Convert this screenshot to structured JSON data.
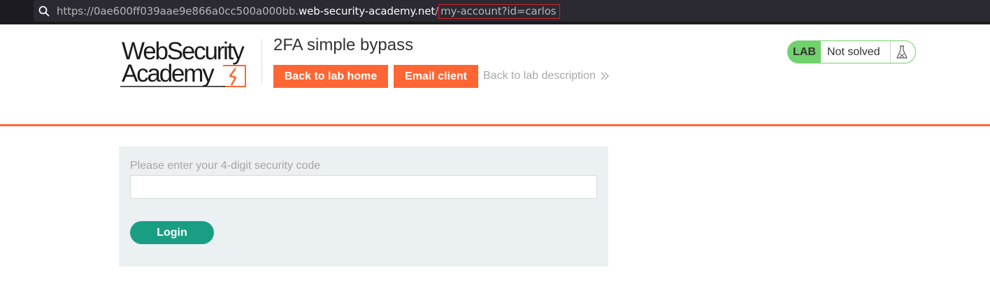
{
  "browser": {
    "url_prefix": "https://0ae600ff039aae9e866a0cc500a000bb.",
    "url_domain": "web-security-academy.net",
    "url_slash": "/",
    "url_path_highlighted": "my-account?id=carlos",
    "highlight_color": "#d2232a"
  },
  "logo": {
    "line1": "WebSecurity",
    "line2": "Academy"
  },
  "header": {
    "lab_title": "2FA simple bypass",
    "back_to_lab_home": "Back to lab home",
    "email_client": "Email client",
    "back_to_description": "Back to lab description"
  },
  "status": {
    "badge": "LAB",
    "text": "Not solved",
    "icon": "flask-icon",
    "badge_color": "#70d16d"
  },
  "form": {
    "label": "Please enter your 4-digit security code",
    "input_value": "",
    "login_label": "Login"
  },
  "colors": {
    "accent_orange": "#ff6633",
    "login_green": "#1a9e83",
    "panel_bg": "#ebf0f2"
  }
}
